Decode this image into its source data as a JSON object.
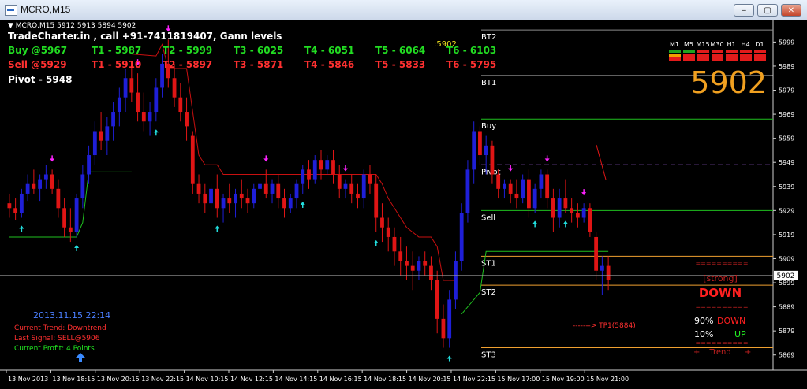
{
  "window": {
    "title": "MCRO,M15",
    "minimize_glyph": "‒",
    "maximize_glyph": "▢",
    "close_glyph": "✕"
  },
  "header": {
    "symbol_line": "▼ MCRO,M15  5912 5913 5894 5902",
    "brand_line": "TradeCharter.in , call +91-7411819407, Gann levels",
    "live_price_small": ":5902",
    "buy_row": [
      "Buy @5967",
      "T1 - 5987",
      "T2 - 5999",
      "T3 - 6025",
      "T4 - 6051",
      "T5 - 6064",
      "T6 - 6103"
    ],
    "sell_row": [
      "Sell @5929",
      "T1 - 5910",
      "T2 - 5897",
      "T3 - 5871",
      "T4 - 5846",
      "T5 - 5833",
      "T6 - 5795"
    ],
    "pivot": "Pivot - 5948"
  },
  "timeframes": {
    "labels": [
      "M1",
      "M5",
      "M15",
      "M30",
      "H1",
      "H4",
      "D1"
    ],
    "colors": {
      "up": "#1fa31f",
      "down": "#e21b1b",
      "neutral": "#f0a000"
    }
  },
  "big_price": "5902",
  "levels": [
    {
      "label": "BT2",
      "value": 6004,
      "color": "#8a8a8a",
      "style": "solid"
    },
    {
      "label": "BT1",
      "value": 5985,
      "color": "#ffffff",
      "style": "solid"
    },
    {
      "label": "Buy",
      "value": 5967,
      "color": "#1fbf1f",
      "style": "solid"
    },
    {
      "label": "Pivot",
      "value": 5948,
      "color": "#a060e0",
      "style": "dashed"
    },
    {
      "label": "Sell",
      "value": 5929,
      "color": "#1fbf1f",
      "style": "solid"
    },
    {
      "label": "ST1",
      "value": 5910,
      "color": "#f0a030",
      "style": "solid"
    },
    {
      "label": "ST2",
      "value": 5898,
      "color": "#f0a030",
      "style": "solid"
    },
    {
      "label": "ST3",
      "value": 5872,
      "color": "#f0a030",
      "style": "solid"
    }
  ],
  "current_price": {
    "value": 5902,
    "label": "5902"
  },
  "status": {
    "datetime": "2013.11.15 22:14",
    "trend": "Current Trend: Downtrend",
    "signal": "Last Signal: SELL@5906",
    "profit": "Current Profit: 4 Points"
  },
  "target_note": "-------> TP1(5884)",
  "strength_panel": {
    "separator": "==========",
    "strength": "[strong]",
    "direction": "DOWN",
    "down_pct": "90%",
    "down_label": "DOWN",
    "up_pct": "10%",
    "up_label": "UP",
    "trend_label": "Trend",
    "trend_bracket_left": "+",
    "trend_bracket_right": "+"
  },
  "chart_data": {
    "type": "candlestick",
    "symbol": "MCRO",
    "timeframe": "M15",
    "ylim": [
      5864,
      6006
    ],
    "y_ticks": [
      5999,
      5989,
      5979,
      5969,
      5959,
      5949,
      5939,
      5929,
      5919,
      5909,
      5899,
      5889,
      5879,
      5869
    ],
    "x_ticks": [
      "13 Nov 2013",
      "13 Nov 18:15",
      "13 Nov 20:15",
      "13 Nov 22:15",
      "14 Nov 10:15",
      "14 Nov 12:15",
      "14 Nov 14:15",
      "14 Nov 16:15",
      "14 Nov 18:15",
      "14 Nov 20:15",
      "14 Nov 22:15",
      "15 Nov 17:00",
      "15 Nov 19:00",
      "15 Nov 21:00"
    ],
    "candles": [
      [
        5932,
        5936,
        5926,
        5930
      ],
      [
        5930,
        5934,
        5925,
        5928
      ],
      [
        5928,
        5938,
        5926,
        5936
      ],
      [
        5936,
        5944,
        5933,
        5940
      ],
      [
        5940,
        5946,
        5936,
        5938
      ],
      [
        5938,
        5944,
        5933,
        5942
      ],
      [
        5942,
        5948,
        5938,
        5944
      ],
      [
        5944,
        5946,
        5936,
        5938
      ],
      [
        5938,
        5942,
        5926,
        5930
      ],
      [
        5930,
        5934,
        5918,
        5922
      ],
      [
        5922,
        5930,
        5916,
        5920
      ],
      [
        5920,
        5936,
        5918,
        5934
      ],
      [
        5934,
        5948,
        5930,
        5944
      ],
      [
        5944,
        5956,
        5940,
        5952
      ],
      [
        5952,
        5966,
        5948,
        5962
      ],
      [
        5962,
        5970,
        5954,
        5958
      ],
      [
        5958,
        5968,
        5952,
        5964
      ],
      [
        5964,
        5974,
        5958,
        5970
      ],
      [
        5970,
        5980,
        5964,
        5976
      ],
      [
        5976,
        5988,
        5970,
        5984
      ],
      [
        5984,
        5990,
        5974,
        5978
      ],
      [
        5978,
        5986,
        5966,
        5970
      ],
      [
        5970,
        5978,
        5962,
        5966
      ],
      [
        5966,
        5974,
        5960,
        5970
      ],
      [
        5970,
        5984,
        5966,
        5980
      ],
      [
        5980,
        5994,
        5976,
        5990
      ],
      [
        5990,
        6000,
        5980,
        5984
      ],
      [
        5984,
        5990,
        5972,
        5976
      ],
      [
        5976,
        5982,
        5966,
        5970
      ],
      [
        5970,
        5976,
        5958,
        5964
      ],
      [
        5960,
        5962,
        5936,
        5940
      ],
      [
        5940,
        5944,
        5932,
        5936
      ],
      [
        5936,
        5940,
        5928,
        5932
      ],
      [
        5932,
        5940,
        5930,
        5938
      ],
      [
        5938,
        5944,
        5926,
        5930
      ],
      [
        5930,
        5936,
        5924,
        5934
      ],
      [
        5934,
        5940,
        5928,
        5932
      ],
      [
        5932,
        5938,
        5926,
        5936
      ],
      [
        5936,
        5942,
        5930,
        5934
      ],
      [
        5934,
        5938,
        5928,
        5932
      ],
      [
        5932,
        5940,
        5930,
        5938
      ],
      [
        5938,
        5944,
        5934,
        5940
      ],
      [
        5940,
        5946,
        5934,
        5936
      ],
      [
        5936,
        5942,
        5932,
        5940
      ],
      [
        5940,
        5944,
        5930,
        5934
      ],
      [
        5934,
        5938,
        5926,
        5930
      ],
      [
        5930,
        5936,
        5928,
        5934
      ],
      [
        5934,
        5942,
        5930,
        5940
      ],
      [
        5940,
        5948,
        5936,
        5946
      ],
      [
        5946,
        5950,
        5938,
        5942
      ],
      [
        5942,
        5952,
        5940,
        5950
      ],
      [
        5950,
        5954,
        5942,
        5946
      ],
      [
        5946,
        5952,
        5944,
        5950
      ],
      [
        5950,
        5954,
        5940,
        5944
      ],
      [
        5944,
        5948,
        5934,
        5938
      ],
      [
        5938,
        5942,
        5934,
        5940
      ],
      [
        5940,
        5944,
        5932,
        5936
      ],
      [
        5936,
        5940,
        5930,
        5934
      ],
      [
        5934,
        5946,
        5930,
        5944
      ],
      [
        5944,
        5948,
        5936,
        5940
      ],
      [
        5940,
        5944,
        5920,
        5926
      ],
      [
        5926,
        5932,
        5916,
        5922
      ],
      [
        5922,
        5926,
        5912,
        5918
      ],
      [
        5918,
        5922,
        5906,
        5912
      ],
      [
        5912,
        5918,
        5902,
        5908
      ],
      [
        5908,
        5914,
        5900,
        5906
      ],
      [
        5906,
        5912,
        5896,
        5904
      ],
      [
        5904,
        5910,
        5900,
        5908
      ],
      [
        5908,
        5912,
        5902,
        5906
      ],
      [
        5906,
        5910,
        5896,
        5900
      ],
      [
        5900,
        5904,
        5878,
        5884
      ],
      [
        5884,
        5890,
        5872,
        5876
      ],
      [
        5876,
        5896,
        5872,
        5892
      ],
      [
        5892,
        5912,
        5888,
        5908
      ],
      [
        5908,
        5932,
        5904,
        5928
      ],
      [
        5928,
        5950,
        5924,
        5946
      ],
      [
        5946,
        5966,
        5940,
        5962
      ],
      [
        5962,
        5964,
        5948,
        5952
      ],
      [
        5952,
        5960,
        5944,
        5956
      ],
      [
        5956,
        5958,
        5940,
        5944
      ],
      [
        5944,
        5946,
        5934,
        5938
      ],
      [
        5938,
        5942,
        5934,
        5940
      ],
      [
        5940,
        5942,
        5932,
        5936
      ],
      [
        5936,
        5942,
        5930,
        5934
      ],
      [
        5934,
        5944,
        5932,
        5942
      ],
      [
        5942,
        5946,
        5926,
        5930
      ],
      [
        5930,
        5940,
        5928,
        5938
      ],
      [
        5938,
        5946,
        5934,
        5944
      ],
      [
        5944,
        5946,
        5930,
        5934
      ],
      [
        5934,
        5938,
        5920,
        5926
      ],
      [
        5926,
        5938,
        5922,
        5934
      ],
      [
        5934,
        5942,
        5928,
        5930
      ],
      [
        5930,
        5934,
        5924,
        5928
      ],
      [
        5928,
        5932,
        5922,
        5926
      ],
      [
        5926,
        5932,
        5924,
        5930
      ],
      [
        5930,
        5932,
        5918,
        5920
      ],
      [
        5918,
        5920,
        5900,
        5904
      ],
      [
        5904,
        5910,
        5894,
        5906
      ],
      [
        5906,
        5910,
        5896,
        5900
      ]
    ],
    "candle_colors": {
      "up": "#1f1fd8",
      "down": "#e01515"
    },
    "trailing_stop": {
      "down_color": "#c81010",
      "up_color": "#1fbf1f"
    },
    "signal_arrows": {
      "sell_color": "#ff22ff",
      "buy_color": "#22dddd"
    }
  }
}
